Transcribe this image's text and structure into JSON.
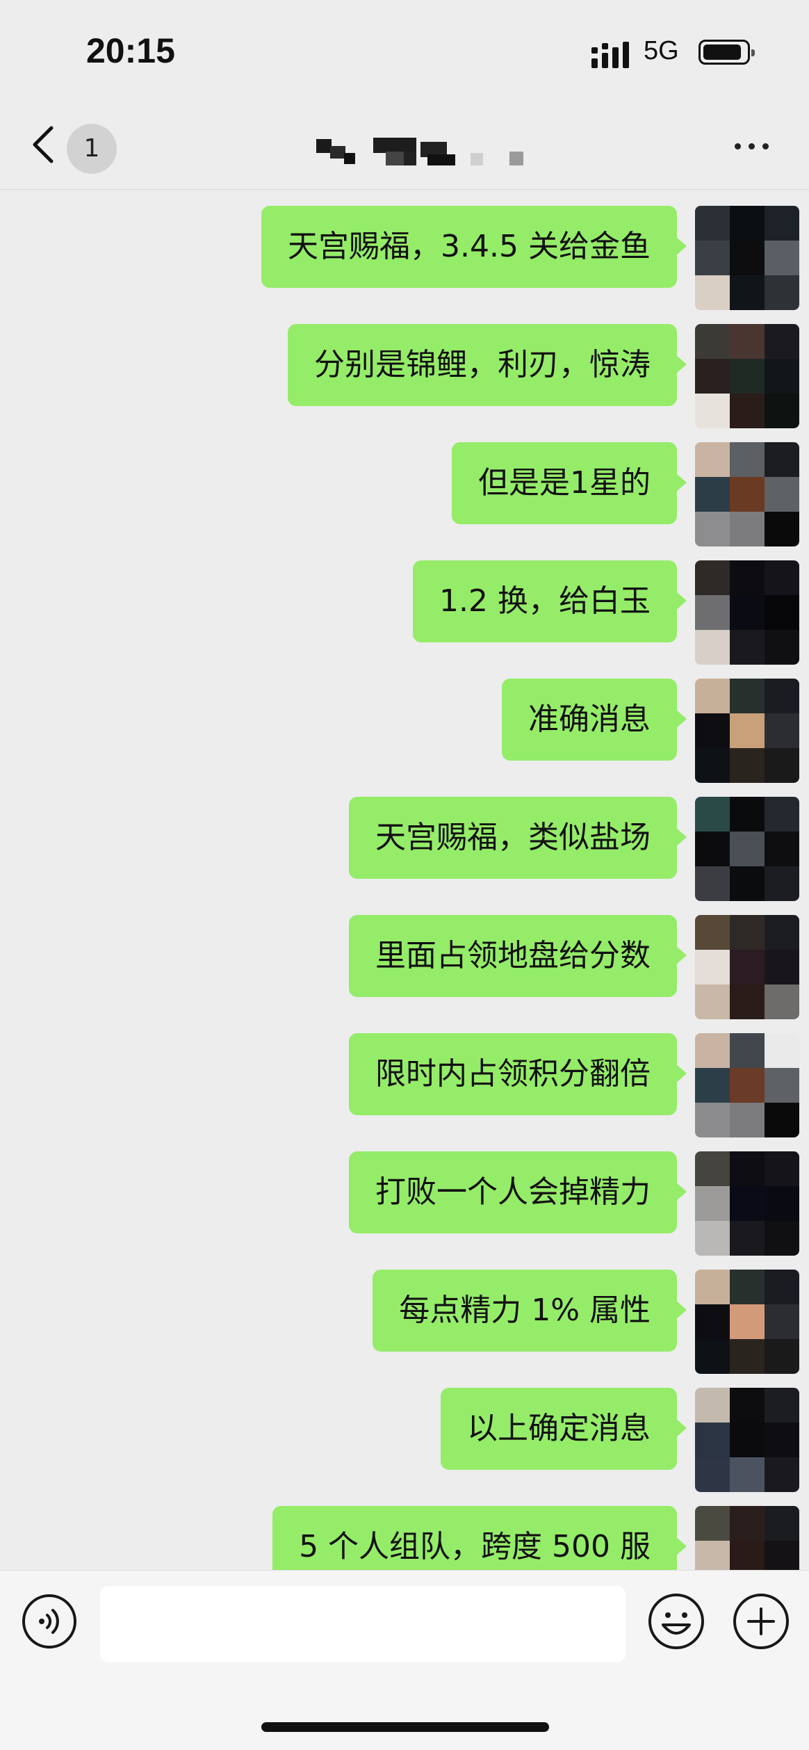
{
  "status_bar": {
    "time": "20:15",
    "network": "5G",
    "icons": [
      "signal-icon",
      "battery-icon"
    ]
  },
  "nav": {
    "back_badge": "1",
    "title_redacted": true,
    "icons": [
      "back-icon",
      "more-icon"
    ]
  },
  "messages": [
    {
      "text": "天宫赐福，3.4.5 关给金鱼",
      "sender": "self"
    },
    {
      "text": "分别是锦鲤，利刃，惊涛",
      "sender": "self"
    },
    {
      "text": "但是是1星的",
      "sender": "self"
    },
    {
      "text": "1.2 换，给白玉",
      "sender": "self"
    },
    {
      "text": "准确消息",
      "sender": "self"
    },
    {
      "text": "天宫赐福，类似盐场",
      "sender": "self"
    },
    {
      "text": "里面占领地盘给分数",
      "sender": "self"
    },
    {
      "text": "限时内占领积分翻倍",
      "sender": "self"
    },
    {
      "text": "打败一个人会掉精力",
      "sender": "self"
    },
    {
      "text": "每点精力 1% 属性",
      "sender": "self"
    },
    {
      "text": "以上确定消息",
      "sender": "self"
    },
    {
      "text": "5 个人组队，跨度 500 服",
      "sender": "self"
    }
  ],
  "input_bar": {
    "value": "",
    "icons": [
      "voice-icon",
      "emoji-icon",
      "plus-icon"
    ]
  },
  "colors": {
    "background": "#ededed",
    "bubble_self": "#95ec69",
    "input_bar": "#f5f5f5"
  }
}
